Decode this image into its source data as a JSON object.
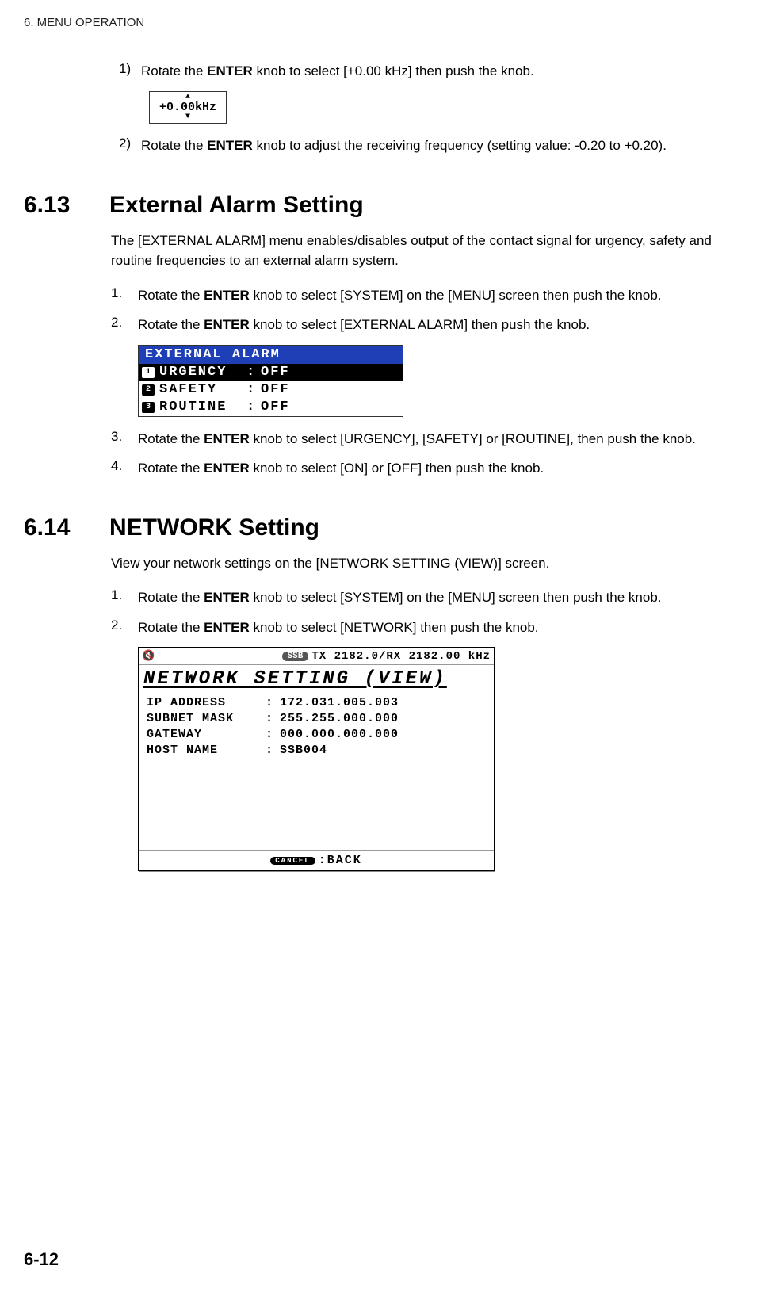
{
  "header": "6.  MENU OPERATION",
  "footer": "6-12",
  "step1": {
    "num": "1)",
    "text_a": "Rotate the ",
    "bold_a": "ENTER",
    "text_b": " knob to select [+0.00 kHz] then push the knob."
  },
  "khz": {
    "up": "▲",
    "value": "+0.00kHz",
    "down": "▼"
  },
  "step2": {
    "num": "2)",
    "text_a": "Rotate the ",
    "bold_a": "ENTER",
    "text_b": " knob to adjust the receiving frequency (setting value: -0.20 to +0.20)."
  },
  "sec613": {
    "num": "6.13",
    "title": "External Alarm Setting",
    "intro": "The [EXTERNAL ALARM] menu enables/disables output of the contact signal for urgency, safety and routine frequencies to an external alarm system.",
    "s1": {
      "num": "1.",
      "a": "Rotate the ",
      "b": "ENTER",
      "c": " knob to select [SYSTEM] on the [MENU] screen then push the knob."
    },
    "s2": {
      "num": "2.",
      "a": "Rotate the ",
      "b": "ENTER",
      "c": " knob to select [EXTERNAL ALARM] then push the knob."
    },
    "box": {
      "title": "EXTERNAL ALARM",
      "rows": [
        {
          "idx": "1",
          "label": "URGENCY",
          "val": "OFF"
        },
        {
          "idx": "2",
          "label": "SAFETY",
          "val": "OFF"
        },
        {
          "idx": "3",
          "label": "ROUTINE",
          "val": "OFF"
        }
      ]
    },
    "s3": {
      "num": "3.",
      "a": "Rotate the ",
      "b": "ENTER",
      "c": " knob to select [URGENCY], [SAFETY] or [ROUTINE], then push the knob."
    },
    "s4": {
      "num": "4.",
      "a": "Rotate the ",
      "b": "ENTER",
      "c": " knob to select [ON] or [OFF] then push the knob."
    }
  },
  "sec614": {
    "num": "6.14",
    "title": "NETWORK Setting",
    "intro": "View your network settings on the [NETWORK SETTING (VIEW)] screen.",
    "s1": {
      "num": "1.",
      "a": "Rotate the ",
      "b": "ENTER",
      "c": " knob to select [SYSTEM] on the [MENU] screen then push the knob."
    },
    "s2": {
      "num": "2.",
      "a": "Rotate the ",
      "b": "ENTER",
      "c": " knob to select [NETWORK] then push the knob."
    },
    "box": {
      "spk": "🔇",
      "ssb": "SSB",
      "freq": "TX 2182.0/RX 2182.00 kHz",
      "title": "NETWORK SETTING (VIEW)",
      "rows": [
        {
          "k": "IP ADDRESS",
          "v": "172.031.005.003"
        },
        {
          "k": "SUBNET MASK",
          "v": "255.255.000.000"
        },
        {
          "k": "GATEWAY",
          "v": "000.000.000.000"
        },
        {
          "k": "HOST NAME",
          "v": "SSB004"
        }
      ],
      "cancel": "CANCEL",
      "back": ":BACK"
    }
  }
}
